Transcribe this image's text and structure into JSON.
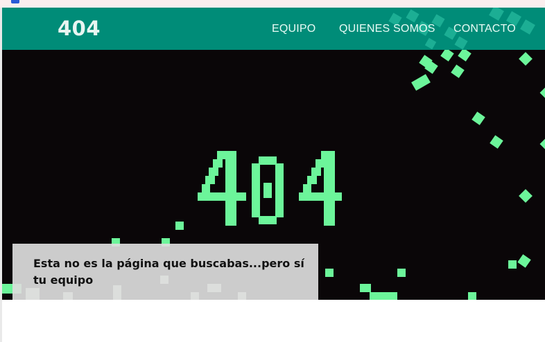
{
  "colors": {
    "navbar": "#008c78",
    "hero_background": "#0a0608",
    "pixel_green": "#6cf59a",
    "pixel_light": "#d8f8e2"
  },
  "header": {
    "logo": "404",
    "nav": [
      {
        "label": "EQUIPO"
      },
      {
        "label": "QUIENES SOMOS"
      },
      {
        "label": "CONTACTO"
      }
    ]
  },
  "hero": {
    "big_text": "404",
    "message": "Esta no es la página que buscabas...pero sí tu equipo"
  }
}
